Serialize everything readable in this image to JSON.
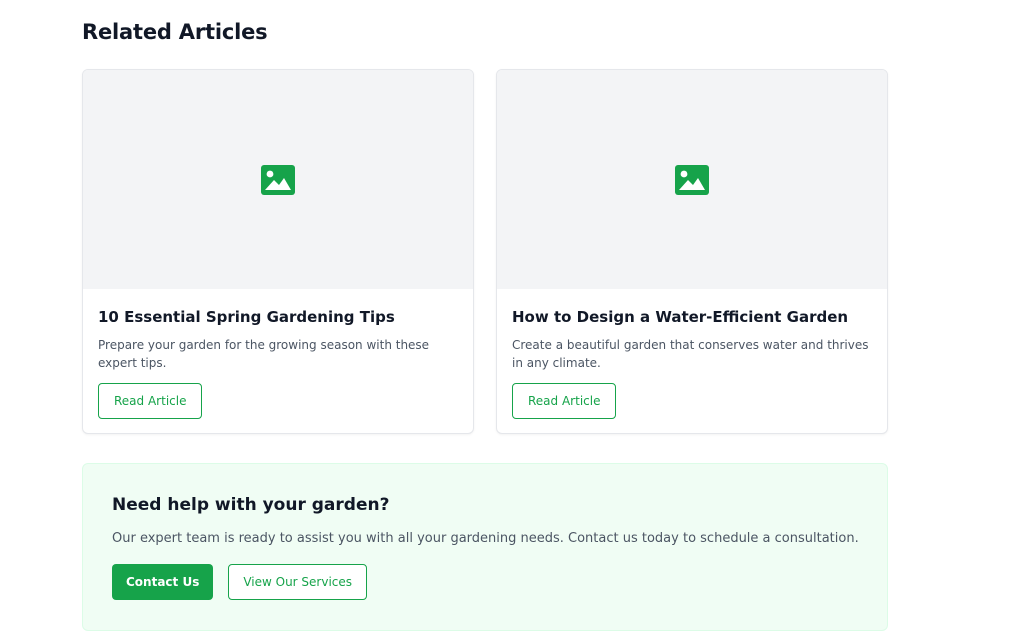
{
  "related": {
    "title": "Related Articles",
    "articles": [
      {
        "image_icon": "image-icon",
        "title": "10 Essential Spring Gardening Tips",
        "description": "Prepare your garden for the growing season with these expert tips.",
        "button_label": "Read Article"
      },
      {
        "image_icon": "image-icon",
        "title": "How to Design a Water-Efficient Garden",
        "description": "Create a beautiful garden that conserves water and thrives in any climate.",
        "button_label": "Read Article"
      }
    ]
  },
  "cta": {
    "title": "Need help with your garden?",
    "text": "Our expert team is ready to assist you with all your gardening needs. Contact us today to schedule a consultation.",
    "primary_label": "Contact Us",
    "secondary_label": "View Our Services"
  },
  "colors": {
    "accent": "#16a34a",
    "image_placeholder_bg": "#f3f4f6",
    "cta_bg": "#f0fdf4"
  }
}
